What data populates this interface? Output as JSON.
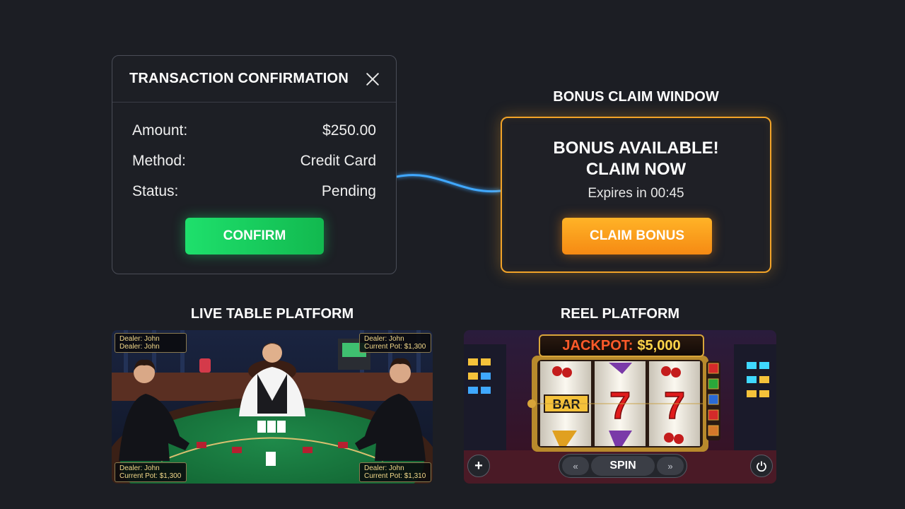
{
  "transaction": {
    "title": "TRANSACTION CONFIRMATION",
    "rows": [
      {
        "label": "Amount:",
        "value": "$250.00"
      },
      {
        "label": "Method:",
        "value": "Credit Card"
      },
      {
        "label": "Status:",
        "value": "Pending"
      }
    ],
    "confirm_label": "CONFIRM",
    "close_icon": "close-icon"
  },
  "bonus": {
    "heading": "BONUS CLAIM WINDOW",
    "line1": "BONUS AVAILABLE!",
    "line2": "CLAIM NOW",
    "expires": "Expires in 00:45",
    "button_label": "CLAIM BONUS",
    "accent_color": "#f2a328"
  },
  "live_table": {
    "heading": "LIVE TABLE PLATFORM",
    "tags": [
      {
        "line1": "Dealer: John",
        "line2": "Dealer: John"
      },
      {
        "line1": "Dealer: John",
        "line2": "Current Pot: $1,300"
      },
      {
        "line1": "Dealer: John",
        "line2": "Current Pot: $1,300"
      },
      {
        "line1": "Dealer: John",
        "line2": "Current Pot: $1,310"
      }
    ]
  },
  "reel": {
    "heading": "REEL PLATFORM",
    "jackpot_label": "JACKPOT:",
    "jackpot_amount": "$5,000",
    "spin_label": "SPIN",
    "left_icon": "rewind-icon",
    "right_icon": "fast-forward-icon",
    "add_icon": "plus-icon",
    "power_icon": "power-icon",
    "reel_symbols": [
      "BAR",
      "7",
      "7"
    ]
  },
  "colors": {
    "background": "#1c1e24",
    "confirm_green": "#1ee06c",
    "bonus_orange": "#f68a13",
    "connector_blue": "#3fa8ff"
  }
}
